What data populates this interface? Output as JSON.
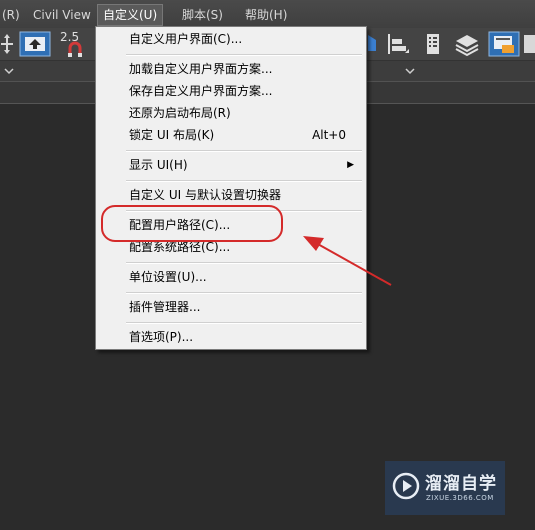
{
  "menubar": {
    "items": [
      "(R)",
      "Civil View",
      "自定义(U)",
      "脚本(S)",
      "帮助(H)"
    ],
    "active_index": 2
  },
  "toolbar": {
    "snap_value": "2.5"
  },
  "menu": {
    "items": [
      {
        "label": "自定义用户界面(C)...",
        "shortcut": ""
      },
      {
        "label": "加载自定义用户界面方案...",
        "shortcut": ""
      },
      {
        "label": "保存自定义用户界面方案...",
        "shortcut": ""
      },
      {
        "label": "还原为启动布局(R)",
        "shortcut": ""
      },
      {
        "label": "锁定 UI 布局(K)",
        "shortcut": "Alt+0"
      },
      {
        "label": "显示 UI(H)",
        "shortcut": "",
        "submenu": true
      },
      {
        "label": "自定义 UI 与默认设置切换器",
        "shortcut": ""
      },
      {
        "label": "配置用户路径(C)...",
        "shortcut": "",
        "highlighted": true
      },
      {
        "label": "配置系统路径(C)...",
        "shortcut": ""
      },
      {
        "label": "单位设置(U)...",
        "shortcut": ""
      },
      {
        "label": "插件管理器...",
        "shortcut": ""
      },
      {
        "label": "首选项(P)...",
        "shortcut": ""
      }
    ]
  },
  "annotation": {
    "color": "#d42a2a"
  },
  "watermark": {
    "title": "溜溜自学",
    "subtitle": "ZIXUE.3D66.COM"
  },
  "colors": {
    "menu_bg": "#f0f0f0",
    "menubar_bg": "#444444",
    "viewport_bg": "#2b2b2b",
    "active_tool": "#2f6fb4"
  }
}
